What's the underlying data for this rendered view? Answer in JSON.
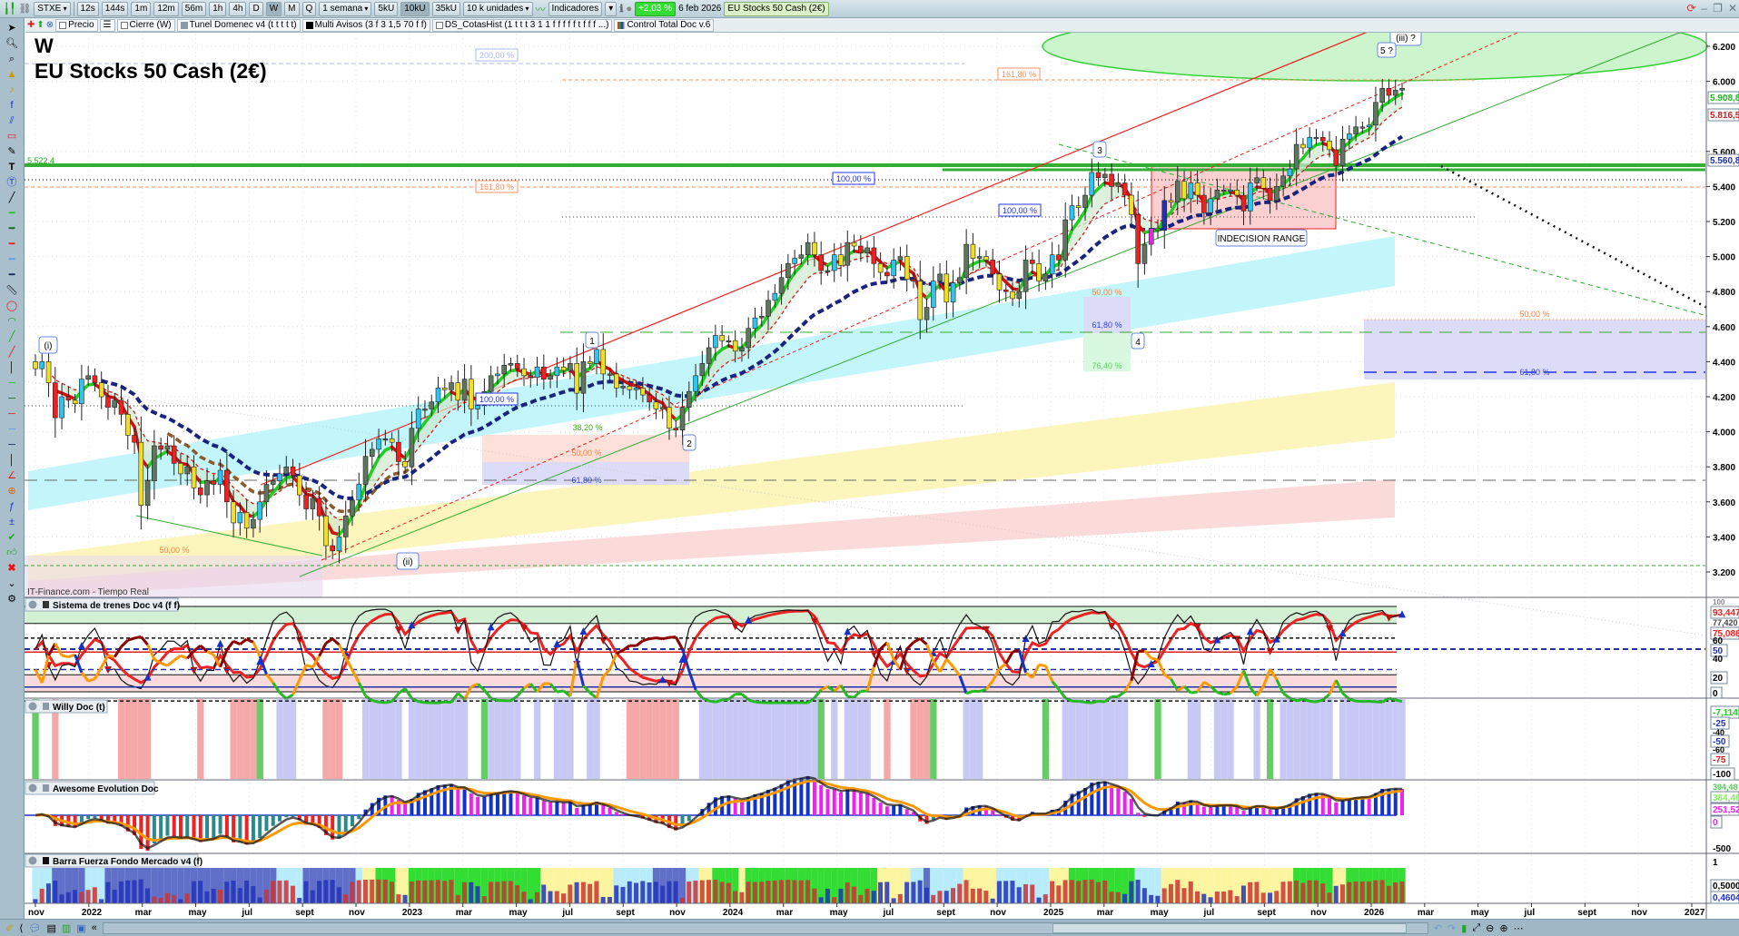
{
  "toolbar": {
    "symbol": "STXE",
    "timeframes": [
      "12s",
      "144s",
      "1m",
      "12m",
      "56m",
      "1h",
      "4h",
      "D",
      "W",
      "M",
      "Q"
    ],
    "period": "1 semana",
    "units": [
      "5kU",
      "10kU",
      "35kU"
    ],
    "units_select": "10 k unidades",
    "indicators": "Indicadores",
    "change": "+2,03 %",
    "date": "6 feb 2026",
    "instrument": "EU Stocks 50 Cash (2€)"
  },
  "legend_bar": {
    "items": [
      "Precio",
      "Cierre (W)",
      "Tunel Domenec v4 (t t t t t)",
      "Multi Avisos (3 f 3 1,5 70 f f)",
      "DS_CotasHist (1 t t t 3 1 1 f f f f f t f f f ...)",
      "Control Total Doc v.6"
    ]
  },
  "chart": {
    "timeframe_label": "W",
    "title": "EU Stocks 50 Cash (2€)",
    "source": "IT-Finance.com - Tiempo Real",
    "level_label": "5.522,4",
    "fib": {
      "f200": "200,00 %",
      "f1618a": "161,80 %",
      "f1618b": "161,80 %",
      "f100a": "100,00 %",
      "f100b": "100,00 %",
      "f100c": "100,00 %",
      "f382": "38,20 %",
      "f50a": "50,00 %",
      "f618a": "61,80 %",
      "f50b": "50,00 %",
      "f50c": "50,00 %",
      "f618b": "61,80 %",
      "f764": "76,40 %",
      "f50d": "50,00 %",
      "f618c": "61,80 %"
    },
    "waves": {
      "i": "(i)",
      "ii": "(ii)",
      "iii": "(iii) ?",
      "w1": "1",
      "w2": "2",
      "w3": "3",
      "w4": "4",
      "w5": "5 ?"
    },
    "range_label": "INDECISION RANGE",
    "price_tags": {
      "ema_fast": "5.908,8",
      "ema_mid": "5.816,5",
      "ema_slow": "5.560,8"
    },
    "colors": {
      "up": "#5f7560",
      "up_alt": "#2ec4f0",
      "down": "#f02020",
      "down_alt": "#f0e020",
      "ema_fast": "#22cc22",
      "ema_slow": "#1a237e"
    }
  },
  "panels": {
    "sistema": {
      "title": "Sistema de trenes Doc v4 (f f)",
      "axis": [
        "100",
        "60",
        "40",
        "20",
        "0"
      ],
      "tags": [
        "93,447",
        "77,420",
        "75,086",
        "50"
      ]
    },
    "willy": {
      "title": "Willy Doc (t)",
      "axis": [
        "-40",
        "-60"
      ],
      "tags": [
        "-7,1141",
        "-25",
        "-50",
        "-75",
        "-100"
      ]
    },
    "awesome": {
      "title": "Awesome Evolution Doc",
      "axis": [
        "-500"
      ],
      "tags": [
        "394,48",
        "384,46",
        "251,52",
        "0"
      ]
    },
    "barra": {
      "title": "Barra Fuerza Fondo Mercado v4 (f)",
      "axis": [
        "1"
      ],
      "tags": [
        "0,5000",
        "0,4604"
      ]
    }
  },
  "chart_data": {
    "type": "candlestick",
    "title": "EU Stocks 50 Cash (2€)",
    "timeframe": "weekly",
    "start_week": "2021-11",
    "end_date": "6 feb 2026",
    "ylim": [
      3100,
      6300
    ],
    "price_axis_labels": [
      "6.200",
      "6.000",
      "5.600",
      "5.400",
      "5.200",
      "5.000",
      "4.800",
      "4.600",
      "4.400",
      "4.200",
      "4.000",
      "3.800",
      "3.600",
      "3.400",
      "3.200"
    ],
    "date_axis": [
      {
        "label": "nov",
        "month": 0
      },
      {
        "label": "2022",
        "month": 2
      },
      {
        "label": "mar",
        "month": 4
      },
      {
        "label": "may",
        "month": 6
      },
      {
        "label": "jul",
        "month": 8
      },
      {
        "label": "sept",
        "month": 10
      },
      {
        "label": "nov",
        "month": 12
      },
      {
        "label": "2023",
        "month": 14
      },
      {
        "label": "mar",
        "month": 16
      },
      {
        "label": "may",
        "month": 18
      },
      {
        "label": "jul",
        "month": 20
      },
      {
        "label": "sept",
        "month": 22
      },
      {
        "label": "nov",
        "month": 24
      },
      {
        "label": "2024",
        "month": 26
      },
      {
        "label": "mar",
        "month": 28
      },
      {
        "label": "may",
        "month": 30
      },
      {
        "label": "jul",
        "month": 32
      },
      {
        "label": "sept",
        "month": 34
      },
      {
        "label": "nov",
        "month": 36
      },
      {
        "label": "2025",
        "month": 38
      },
      {
        "label": "mar",
        "month": 40
      },
      {
        "label": "may",
        "month": 42
      },
      {
        "label": "jul",
        "month": 44
      },
      {
        "label": "sept",
        "month": 46
      },
      {
        "label": "nov",
        "month": 48
      },
      {
        "label": "2026",
        "month": 50
      },
      {
        "label": "mar",
        "month": 52
      },
      {
        "label": "may",
        "month": 54
      },
      {
        "label": "jul",
        "month": 56
      },
      {
        "label": "sept",
        "month": 58
      },
      {
        "label": "nov",
        "month": 60
      },
      {
        "label": "2027",
        "month": 62
      }
    ],
    "closes": [
      4360,
      4400,
      4280,
      4080,
      4200,
      4180,
      4160,
      4300,
      4320,
      4280,
      4200,
      4140,
      4180,
      4100,
      3980,
      3940,
      3580,
      3720,
      3920,
      3900,
      3920,
      3820,
      3760,
      3800,
      3680,
      3640,
      3720,
      3700,
      3780,
      3600,
      3480,
      3540,
      3450,
      3500,
      3600,
      3700,
      3720,
      3760,
      3800,
      3750,
      3640,
      3560,
      3620,
      3520,
      3350,
      3320,
      3400,
      3520,
      3610,
      3700,
      3860,
      3900,
      3960,
      3960,
      3940,
      3830,
      3800,
      4020,
      4130,
      4130,
      4170,
      4250,
      4240,
      4280,
      4180,
      4300,
      4130,
      4150,
      4230,
      4320,
      4330,
      4380,
      4390,
      4360,
      4320,
      4310,
      4370,
      4300,
      4320,
      4370,
      4350,
      4390,
      4220,
      4400,
      4390,
      4470,
      4330,
      4330,
      4250,
      4260,
      4240,
      4250,
      4210,
      4170,
      4130,
      4140,
      4020,
      4010,
      4140,
      4230,
      4320,
      4390,
      4480,
      4550,
      4520,
      4520,
      4460,
      4480,
      4590,
      4650,
      4660,
      4750,
      4790,
      4880,
      4960,
      4990,
      5010,
      5080,
      5010,
      4920,
      4920,
      5010,
      4950,
      5080,
      5060,
      5020,
      5050,
      4960,
      4910,
      4890,
      4980,
      5000,
      4870,
      4860,
      4640,
      4710,
      4860,
      4900,
      4740,
      4850,
      4880,
      5070,
      4990,
      5000,
      4980,
      4900,
      4810,
      4800,
      4760,
      4800,
      4980,
      4960,
      4860,
      4900,
      5010,
      4980,
      5210,
      5290,
      5280,
      5350,
      5480,
      5450,
      5470,
      5400,
      5420,
      5350,
      5240,
      4960,
      5070,
      5160,
      5150,
      5320,
      5310,
      5430,
      5330,
      5420,
      5350,
      5250,
      5330,
      5380,
      5380,
      5380,
      5350,
      5260,
      5420,
      5450,
      5390,
      5320,
      5400,
      5460,
      5500,
      5640,
      5620,
      5680,
      5680,
      5660,
      5610,
      5520,
      5670,
      5700,
      5740,
      5740,
      5750,
      5880,
      5960,
      5920,
      5950,
      5960
    ]
  }
}
